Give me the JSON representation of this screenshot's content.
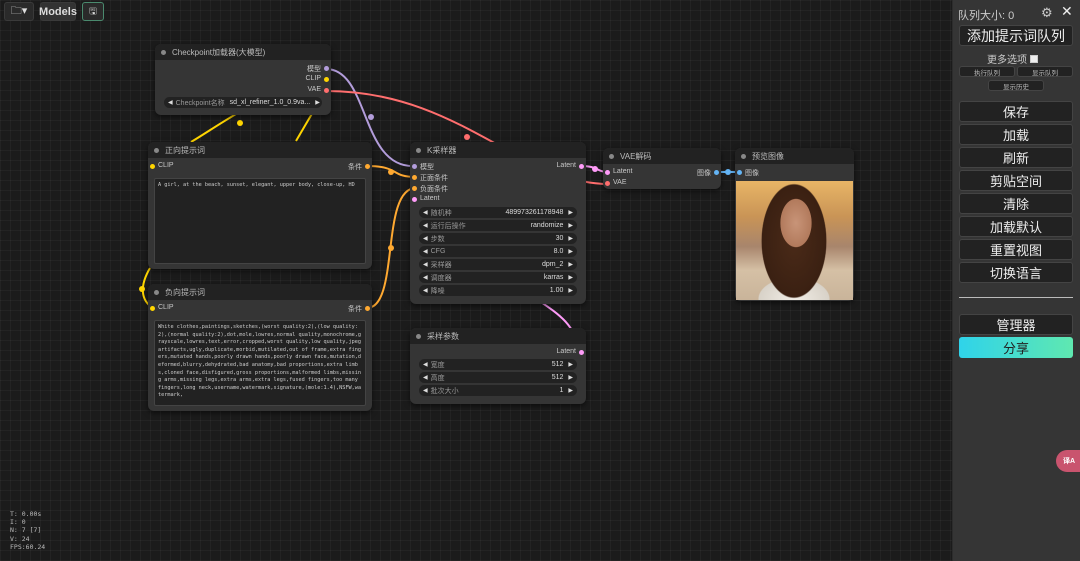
{
  "toolbar": {
    "folder_icon": "folder-icon",
    "models_label": "Models",
    "save_icon": "save-icon"
  },
  "nodes": {
    "checkpoint": {
      "title": "Checkpoint加载器(大模型)",
      "outputs": [
        "模型",
        "CLIP",
        "VAE"
      ],
      "widget_label": "Checkpoint名称",
      "widget_value": "sd_xl_refiner_1.0_0.9va..."
    },
    "positive": {
      "title": "正向提示词",
      "input": "CLIP",
      "output": "条件",
      "text": "A girl, at the beach, sunset, elegant, upper body, close-up, HD"
    },
    "negative": {
      "title": "负向提示词",
      "input": "CLIP",
      "output": "条件",
      "text": "White clothes,paintings,sketches,(worst quality:2),(low quality:2),(normal quality:2),dot,mole,lowres,normal quality,monochrome,grayscale,lowres,text,error,cropped,worst quality,low quality,jpeg artifacts,ugly,duplicate,morbid,mutilated,out of frame,extra fingers,mutated hands,poorly drawn hands,poorly drawn face,mutation,deformed,blurry,dehydrated,bad anatomy,bad proportions,extra limbs,cloned face,disfigured,gross proportions,malformed limbs,missing arms,missing legs,extra arms,extra legs,fused fingers,too many fingers,long neck,username,watermark,signature,(mole:1.4),NSFW,watermark,"
    },
    "ksampler": {
      "title": "K采样器",
      "inputs": [
        "模型",
        "正面条件",
        "负面条件",
        "Latent"
      ],
      "output": "Latent",
      "widgets": [
        {
          "label": "随机种",
          "value": "489973261178948"
        },
        {
          "label": "运行后操作",
          "value": "randomize"
        },
        {
          "label": "步数",
          "value": "30"
        },
        {
          "label": "CFG",
          "value": "8.0"
        },
        {
          "label": "采样器",
          "value": "dpm_2"
        },
        {
          "label": "调度器",
          "value": "karras"
        },
        {
          "label": "降噪",
          "value": "1.00"
        }
      ]
    },
    "vae": {
      "title": "VAE解码",
      "inputs": [
        "Latent",
        "VAE"
      ],
      "output": "图像"
    },
    "preview": {
      "title": "预览图像",
      "input": "图像"
    },
    "sampler_params": {
      "title": "采样参数",
      "output": "Latent",
      "widgets": [
        {
          "label": "宽度",
          "value": "512"
        },
        {
          "label": "高度",
          "value": "512"
        },
        {
          "label": "批次大小",
          "value": "1"
        }
      ]
    }
  },
  "stats": [
    "T: 0.00s",
    "I: 0",
    "N: 7 [7]",
    "V: 24",
    "FPS:60.24"
  ],
  "panel": {
    "queue_size": "队列大小: 0",
    "gear_icon": "gear-icon",
    "close_icon": "close-icon",
    "queue_prompt": "添加提示词队列",
    "more_options": "更多选项",
    "view_queue": "执行队列",
    "view_queue2": "显示队列",
    "view_history": "显示历史",
    "buttons": [
      "保存",
      "加载",
      "刷新",
      "剪贴空间",
      "清除",
      "加载默认",
      "重置视图",
      "切换语言"
    ],
    "manager": "管理器",
    "share": "分享"
  },
  "translate_badge": "译A",
  "colors": {
    "model": "#b39ddb",
    "clip": "#ffd500",
    "vae": "#ff6e6e",
    "conditioning": "#ffa931",
    "latent": "#ff9cf9",
    "image": "#64b5f6"
  }
}
